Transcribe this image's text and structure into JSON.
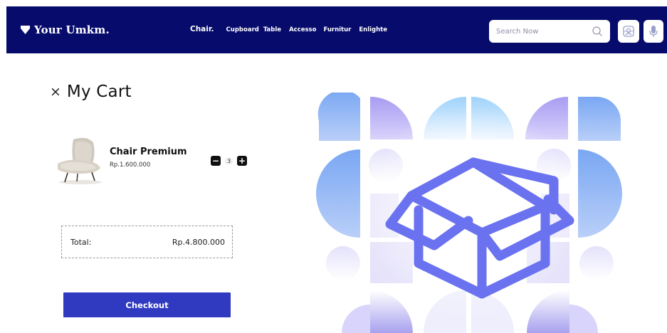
{
  "header": {
    "brand": "Your Umkm.",
    "nav": [
      {
        "label": "Chair.",
        "active": true
      },
      {
        "label": "Cupboard"
      },
      {
        "label": "Table"
      },
      {
        "label": "Accesso"
      },
      {
        "label": "Furnitur"
      },
      {
        "label": "Enlighte"
      }
    ],
    "search_placeholder": "Search Now",
    "icons": [
      "search-icon",
      "face-scan-icon",
      "microphone-icon"
    ]
  },
  "cart": {
    "title": "My Cart",
    "close_symbol": "×",
    "items": [
      {
        "name": "Chair Premium",
        "price": "Rp.1.600.000",
        "quantity": "3",
        "decrease": "−",
        "increase": "+"
      }
    ],
    "total_label": "Total:",
    "total_value": "Rp.4.800.000",
    "checkout_label": "Checkout"
  },
  "colors": {
    "navbar": "#070b6b",
    "checkout": "#2f3ac0",
    "box_illustration": "#6a72f0"
  }
}
